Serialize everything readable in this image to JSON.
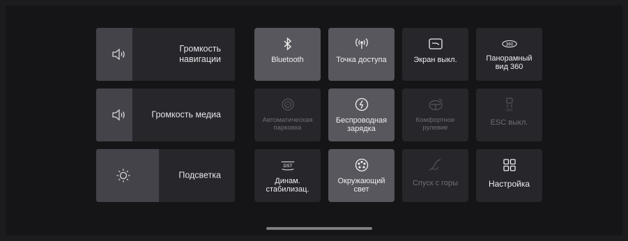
{
  "sliders": [
    {
      "id": "nav-volume",
      "label": "Громкость\nнавигации",
      "icon": "speaker-icon",
      "level": 0.26
    },
    {
      "id": "media-volume",
      "label": "Громкость медиа",
      "icon": "speaker-icon",
      "level": 0.26
    },
    {
      "id": "backlight",
      "label": "Подсветка",
      "icon": "sun-icon",
      "level": 0.45
    }
  ],
  "tiles": [
    {
      "id": "bluetooth",
      "label": "Bluetooth",
      "icon": "bluetooth-icon",
      "state": "active"
    },
    {
      "id": "hotspot",
      "label": "Точка доступа",
      "icon": "hotspot-icon",
      "state": "active"
    },
    {
      "id": "screen-off",
      "label": "Экран выкл.",
      "icon": "screen-off-icon",
      "state": "normal"
    },
    {
      "id": "panoramic-360",
      "label": "Панорамный\nвид 360",
      "icon": "360-view-icon",
      "state": "normal"
    },
    {
      "id": "auto-parking",
      "label": "Автоматическая\nпарковка",
      "icon": "auto-parking-icon",
      "state": "disabled"
    },
    {
      "id": "wireless-charging",
      "label": "Беспроводная\nзарядка",
      "icon": "wireless-charging-icon",
      "state": "active"
    },
    {
      "id": "comfort-steering",
      "label": "Комфортное\nрулевие",
      "icon": "steering-icon",
      "state": "disabled"
    },
    {
      "id": "esc-off",
      "label": "ESC выкл.",
      "icon": "esc-off-icon",
      "state": "disabled"
    },
    {
      "id": "dst",
      "label": "Динам.\nстабилизац.",
      "icon": "dst-icon",
      "state": "normal"
    },
    {
      "id": "ambient-light",
      "label": "Окружающий\nсвет",
      "icon": "ambient-light-icon",
      "state": "active"
    },
    {
      "id": "hill-descent",
      "label": "Спуск с горы",
      "icon": "hill-descent-icon",
      "state": "disabled"
    },
    {
      "id": "settings",
      "label": "Настройка",
      "icon": "grid-icon",
      "state": "normal"
    }
  ],
  "colors": {
    "background": "#151517",
    "tile": "#26262b",
    "tile_active": "#57575d",
    "text": "#f0f0f2",
    "text_disabled": "#6e6e74"
  }
}
